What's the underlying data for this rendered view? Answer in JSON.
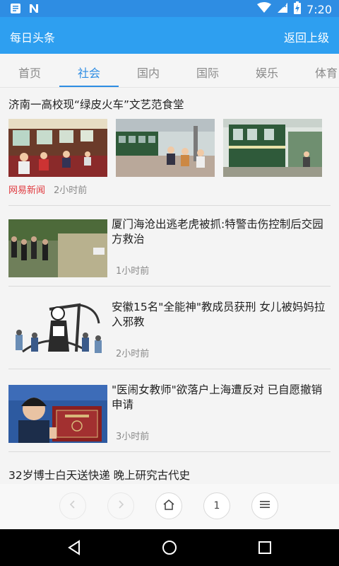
{
  "status_bar": {
    "time": "7:20",
    "icons": [
      "notes-icon",
      "n-icon",
      "wifi-icon",
      "signal-icon",
      "battery-charging-icon"
    ]
  },
  "app_bar": {
    "title": "每日头条",
    "back_label": "返回上级"
  },
  "tabs": [
    {
      "label": "首页"
    },
    {
      "label": "社会"
    },
    {
      "label": "国内"
    },
    {
      "label": "国际"
    },
    {
      "label": "娱乐"
    },
    {
      "label": "体育"
    }
  ],
  "active_tab": "社会",
  "feed": {
    "gallery": {
      "title": "济南一高校现“绿皮火车”文艺范食堂",
      "source": "网易新闻",
      "time": "2小时前"
    },
    "articles": [
      {
        "headline": "厦门海沧出逃老虎被抓:特警击伤控制后交园方救治",
        "time": "1小时前"
      },
      {
        "headline": "安徽15名\"全能神\"教成员获刑 女儿被妈妈拉入邪教",
        "time": "2小时前"
      },
      {
        "headline": "\"医闹女教师\"欲落户上海遭反对 已自愿撤销申请",
        "time": "3小时前"
      }
    ],
    "last_title": "32岁博士白天送快递 晚上研究古代史"
  },
  "bottom_nav": {
    "page_number": "1"
  }
}
